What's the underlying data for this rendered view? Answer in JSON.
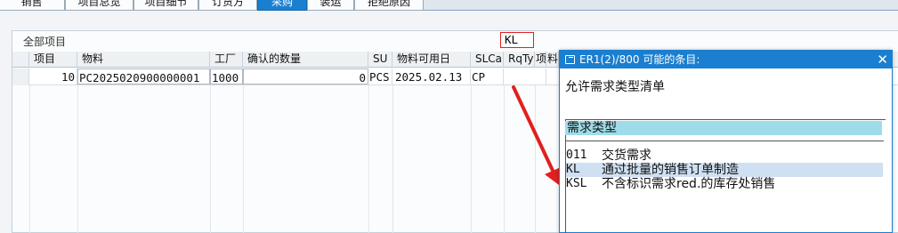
{
  "tabs": [
    "销售",
    "项目总览",
    "项目细节",
    "订货方",
    "采购",
    "装运",
    "拒绝原因"
  ],
  "active_tab": "采购",
  "panel": {
    "title": "全部项目"
  },
  "columns": [
    "项目",
    "物料",
    "工厂",
    "确认的数量",
    "SU",
    "物料可用日",
    "SLCa",
    "RqTy",
    "项",
    "料"
  ],
  "row": {
    "item": "10",
    "material": "PC2025020900000001",
    "plant": "1000",
    "confirmed_qty": "0",
    "su": "PCS",
    "avail_date": "2025.02.13",
    "slca": "CP",
    "rqty": "KL"
  },
  "dialog": {
    "title": "ER1(2)/800 可能的条目:",
    "close": "✕",
    "heading": "允许需求类型清单",
    "col_header": "需求类型",
    "entries": [
      {
        "code": "011",
        "desc": "交货需求"
      },
      {
        "code": "KL",
        "desc": "通过批量的销售订单制造"
      },
      {
        "code": "KSL",
        "desc": "不含标识需求red.的库存处销售"
      }
    ],
    "highlight_color": "#cfe0f2"
  },
  "colors": {
    "accent": "#1a7fd0",
    "annotation": "#e02020"
  }
}
